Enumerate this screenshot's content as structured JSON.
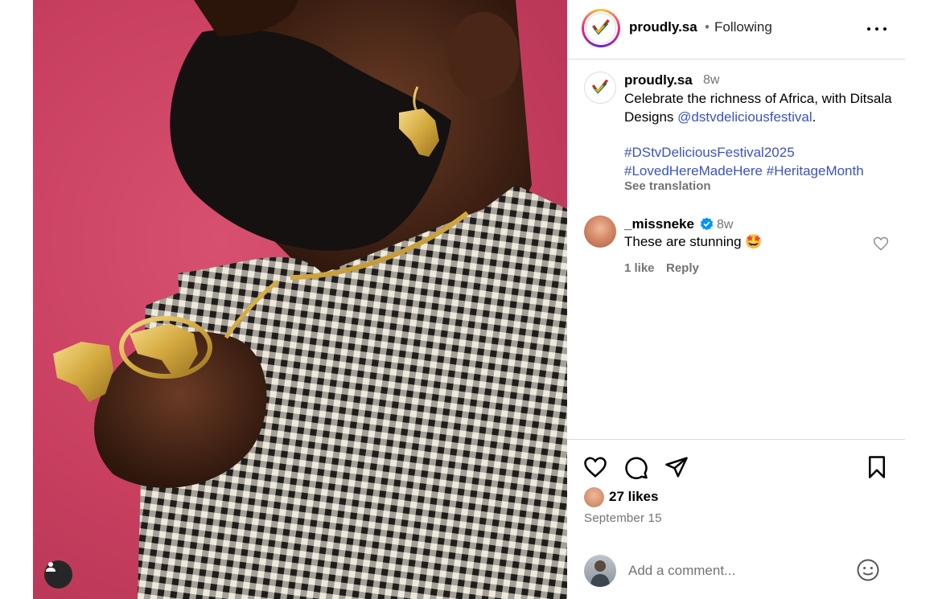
{
  "header": {
    "username": "proudly.sa",
    "dot": "•",
    "follow_status": "Following"
  },
  "caption": {
    "username": "proudly.sa",
    "time": "8w",
    "text_before": "Celebrate the richness of Africa, with Ditsala Designs ",
    "mention": "@dstvdeliciousfestival",
    "text_after": ".",
    "hashtags": [
      "#DStvDeliciousFestival2025",
      "#LovedHereMadeHere",
      "#HeritageMonth"
    ],
    "see_translation": "See translation"
  },
  "comment": {
    "username": "_missneke",
    "verified": true,
    "time": "8w",
    "text": "These are stunning 🤩",
    "likes": "1 like",
    "reply": "Reply"
  },
  "actions": {
    "likes": "27 likes",
    "date": "September 15"
  },
  "comment_box": {
    "placeholder": "Add a comment..."
  },
  "icons": {
    "more": "more-options-icon",
    "like": "heart-icon",
    "comment": "comment-icon",
    "share": "share-icon",
    "save": "bookmark-icon",
    "emoji": "emoji-icon",
    "tag": "user-tag-icon"
  },
  "colors": {
    "link": "#3a53c4",
    "secondary_text": "#737373",
    "divider": "#dbdbdb",
    "photo_background": "#c73e5f",
    "verified": "#0095f6"
  }
}
